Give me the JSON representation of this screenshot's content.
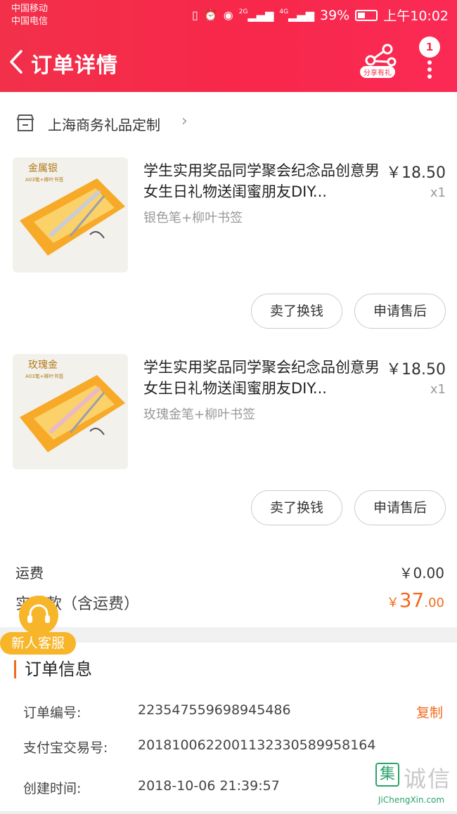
{
  "status_bar": {
    "carrier_1": "中国移动",
    "carrier_2": "中国电信",
    "signal_1": "2G",
    "signal_2": "4G",
    "battery": "39%",
    "time": "上午10:02"
  },
  "header": {
    "title": "订单详情",
    "share_label": "分享有礼",
    "notification_count": "1",
    "bg_color": "#f2304a"
  },
  "shop": {
    "name": "上海商务礼品定制"
  },
  "items": [
    {
      "thumb_text": "金属银",
      "thumb_subtext": "A03笔+柳叶书签",
      "title": "学生实用奖品同学聚会纪念品创意男女生日礼物送闺蜜朋友DIY...",
      "spec": "银色笔+柳叶书签",
      "price": "￥18.50",
      "qty": "x1",
      "sell_label": "卖了换钱",
      "after_sale_label": "申请售后"
    },
    {
      "thumb_text": "玫瑰金",
      "thumb_subtext": "A03笔+柳叶书签",
      "title": "学生实用奖品同学聚会纪念品创意男女生日礼物送闺蜜朋友DIY...",
      "spec": "玫瑰金笔+柳叶书签",
      "price": "￥18.50",
      "qty": "x1",
      "sell_label": "卖了换钱",
      "after_sale_label": "申请售后"
    }
  ],
  "summary": {
    "shipping_label": "运费",
    "shipping_value": "￥0.00",
    "paid_label": "实付款（含运费）",
    "paid_currency": "￥",
    "paid_integer": "37",
    "paid_decimal": ".00",
    "accent_color": "#f26a1e"
  },
  "customer_service": {
    "label": "新人客服"
  },
  "order_info": {
    "title": "订单信息",
    "rows": [
      {
        "label": "订单编号:",
        "value": "223547559698945486",
        "action": "复制"
      },
      {
        "label": "支付宝交易号:",
        "value": "2018100622001132330589958164"
      },
      {
        "label": "创建时间:",
        "value": "2018-10-06 21:39:57"
      }
    ]
  },
  "watermark": {
    "box_char": "集",
    "big_text": "诚信",
    "url": "JiChengXin.com"
  }
}
